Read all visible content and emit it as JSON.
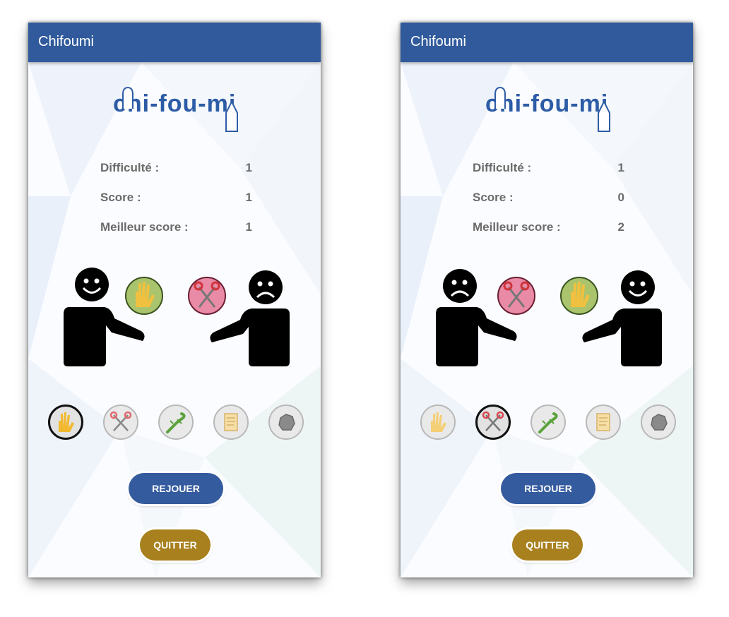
{
  "colors": {
    "appbar": "#305a9c",
    "replay": "#355b9f",
    "quit": "#a8801e",
    "paper_circle": "#9fbf60",
    "scissors_circle": "#e07a9a"
  },
  "screens": [
    {
      "title": "Chifoumi",
      "logo_text": "chi-fou-mi",
      "stats": [
        {
          "label": "Difficulté :",
          "value": "1"
        },
        {
          "label": "Score :",
          "value": "1"
        },
        {
          "label": "Meilleur score :",
          "value": "1"
        }
      ],
      "player": {
        "mood": "happy",
        "pick": "paper-icon"
      },
      "opponent": {
        "mood": "sad",
        "pick": "scissors-icon"
      },
      "choices": [
        "paper-icon",
        "scissors-icon",
        "lizard-icon",
        "scroll-icon",
        "rock-icon"
      ],
      "selected_choice": "paper-icon",
      "replay_label": "REJOUER",
      "quit_label": "QUITTER"
    },
    {
      "title": "Chifoumi",
      "logo_text": "chi-fou-mi",
      "stats": [
        {
          "label": "Difficulté :",
          "value": "1"
        },
        {
          "label": "Score :",
          "value": "0"
        },
        {
          "label": "Meilleur score :",
          "value": "2"
        }
      ],
      "player": {
        "mood": "sad",
        "pick": "scissors-icon"
      },
      "opponent": {
        "mood": "happy",
        "pick": "paper-icon"
      },
      "choices": [
        "paper-icon",
        "scissors-icon",
        "lizard-icon",
        "scroll-icon",
        "rock-icon"
      ],
      "selected_choice": "scissors-icon",
      "replay_label": "REJOUER",
      "quit_label": "QUITTER"
    }
  ]
}
